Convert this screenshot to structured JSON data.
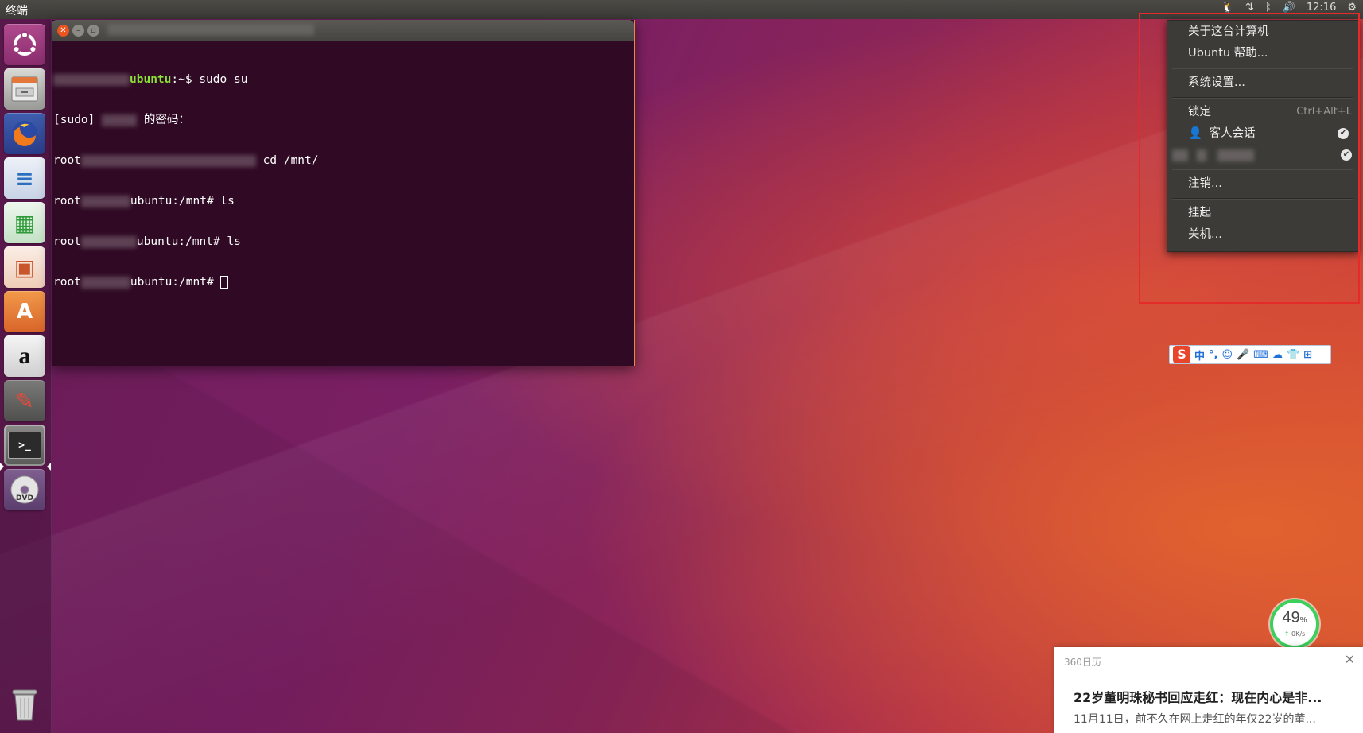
{
  "top_panel": {
    "app_title": "终端",
    "clock": "12:16",
    "tray_icons": [
      "qq-penguin-icon",
      "network-arrows-icon",
      "bluetooth-icon",
      "volume-icon",
      "power-gear-icon"
    ]
  },
  "launcher": {
    "items": [
      {
        "name": "ubuntu-dash",
        "icon": "ubuntu-logo-icon",
        "color": "#e95420"
      },
      {
        "name": "files",
        "icon": "file-cabinet-icon",
        "color": "#9a9a96"
      },
      {
        "name": "firefox",
        "icon": "firefox-icon",
        "color": "#e66000"
      },
      {
        "name": "libreoffice-writer",
        "icon": "writer-doc-icon",
        "color": "#2a6fc0"
      },
      {
        "name": "libreoffice-calc",
        "icon": "calc-sheet-icon",
        "color": "#2f9a39"
      },
      {
        "name": "libreoffice-impress",
        "icon": "impress-slides-icon",
        "color": "#c8552c"
      },
      {
        "name": "ubuntu-software",
        "icon": "shopping-bag-icon",
        "color": "#e8792c"
      },
      {
        "name": "amazon",
        "icon": "amazon-icon",
        "color": "#e7e7e7"
      },
      {
        "name": "system-settings",
        "icon": "wrench-gear-icon",
        "color": "#b93a2e"
      },
      {
        "name": "terminal",
        "icon": "terminal-prompt-icon",
        "color": "#2f2f2f"
      },
      {
        "name": "dvd",
        "icon": "dvd-disc-icon",
        "color": "#cfcfcf"
      },
      {
        "name": "trash",
        "icon": "trash-can-icon",
        "color": "#8a8a86"
      }
    ],
    "glyphs": {
      "firefox": "●",
      "writer": "≡",
      "calc": "▦",
      "impress": "▣",
      "software": "A",
      "amazon": "a",
      "settings": "✎",
      "terminal": ">_",
      "dvd": "DVD"
    }
  },
  "terminal": {
    "window_controls": {
      "close": "✕",
      "minimize": "–",
      "maximize": "▫"
    },
    "lines": [
      {
        "host_suffix": "ubuntu",
        "prompt_tail": ":~$ ",
        "command": "sudo su"
      },
      {
        "text": "[sudo] ",
        "text2": " 的密码："
      },
      {
        "prefix": "root",
        "command": " cd /mnt/"
      },
      {
        "prefix": "root",
        "host_suffix": "ubuntu:/mnt# ",
        "command": "ls"
      },
      {
        "prefix": "root",
        "host_suffix": "ubuntu:/mnt# ",
        "command": "ls"
      },
      {
        "prefix": "root",
        "host_suffix": "ubuntu:/mnt# ",
        "command": ""
      }
    ]
  },
  "system_menu": {
    "about": "关于这台计算机",
    "help": "Ubuntu 帮助...",
    "settings": "系统设置...",
    "lock": "锁定",
    "lock_accel": "Ctrl+Alt+L",
    "guest_session": "客人会话",
    "logout": "注销...",
    "suspend": "挂起",
    "shutdown": "关机...",
    "check_glyph": "✔"
  },
  "ime_bar": {
    "logo": "S",
    "items": [
      "中",
      "°,",
      "☺",
      "🎤",
      "⌨",
      "☁",
      "👕",
      "⊞"
    ]
  },
  "speed_widget": {
    "percent": "49",
    "percent_unit": "%",
    "rate": "0K/s",
    "arrow": "↑"
  },
  "calendar_popup": {
    "source": "360日历",
    "close": "✕",
    "title": "22岁董明珠秘书回应走红：现在内心是非...",
    "snippet": "11月11日，前不久在网上走红的年仅22岁的董..."
  }
}
